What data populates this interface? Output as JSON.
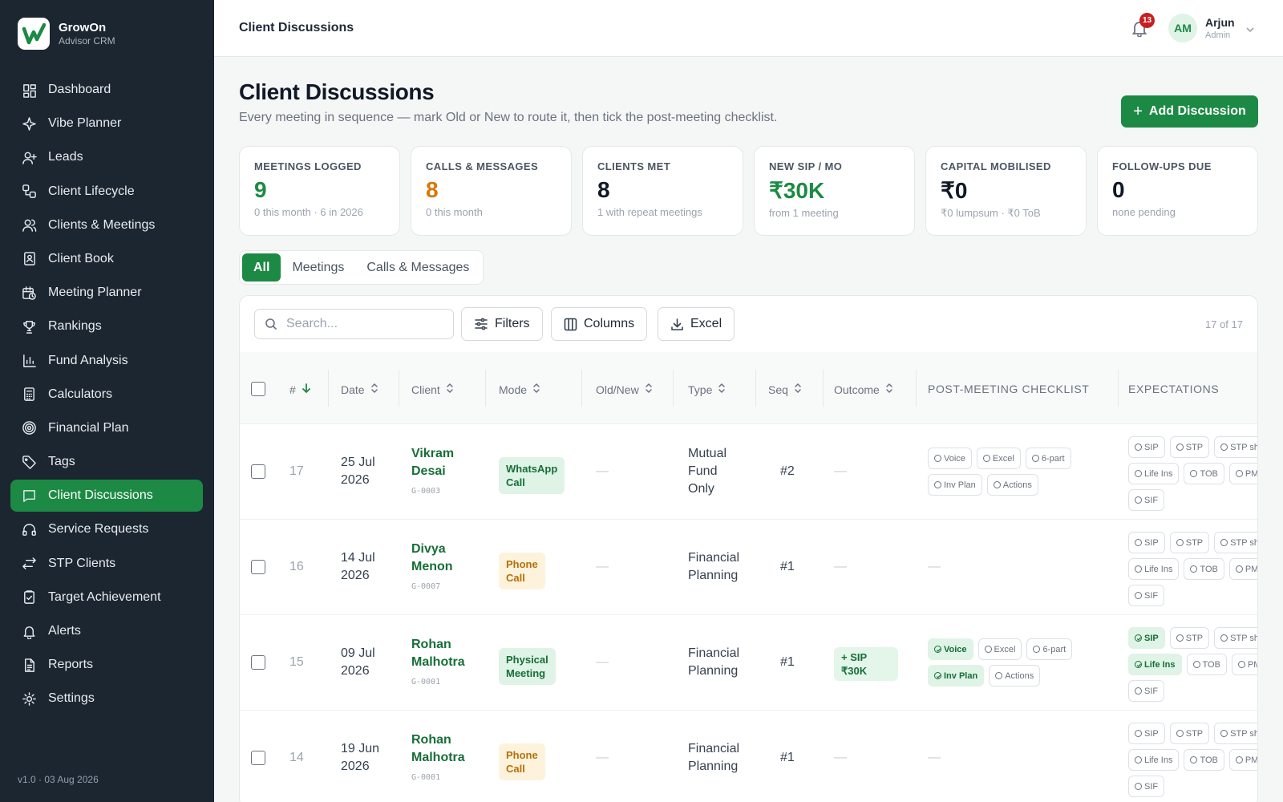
{
  "brand": {
    "name": "GrowOn",
    "sub": "Advisor CRM"
  },
  "nav": [
    {
      "label": "Dashboard",
      "icon": "dashboard-icon"
    },
    {
      "label": "Vibe Planner",
      "icon": "sparkle-icon"
    },
    {
      "label": "Leads",
      "icon": "user-plus-icon"
    },
    {
      "label": "Client Lifecycle",
      "icon": "lifecycle-icon"
    },
    {
      "label": "Clients & Meetings",
      "icon": "users-icon"
    },
    {
      "label": "Client Book",
      "icon": "book-icon"
    },
    {
      "label": "Meeting Planner",
      "icon": "calendar-clock-icon"
    },
    {
      "label": "Rankings",
      "icon": "trophy-icon"
    },
    {
      "label": "Fund Analysis",
      "icon": "bar-chart-icon"
    },
    {
      "label": "Calculators",
      "icon": "calculator-icon"
    },
    {
      "label": "Financial Plan",
      "icon": "target-icon"
    },
    {
      "label": "Tags",
      "icon": "tag-icon"
    },
    {
      "label": "Client Discussions",
      "icon": "message-icon",
      "active": true
    },
    {
      "label": "Service Requests",
      "icon": "headset-icon"
    },
    {
      "label": "STP Clients",
      "icon": "transfer-icon"
    },
    {
      "label": "Target Achievement",
      "icon": "clipboard-check-icon"
    },
    {
      "label": "Alerts",
      "icon": "bell-icon"
    },
    {
      "label": "Reports",
      "icon": "file-text-icon"
    },
    {
      "label": "Settings",
      "icon": "gear-icon"
    }
  ],
  "version": "v1.0 · 03 Aug 2026",
  "topbar": {
    "title": "Client Discussions",
    "notifications": "13",
    "avatar": "AM",
    "user_name": "Arjun",
    "user_role": "Admin"
  },
  "page": {
    "title": "Client Discussions",
    "subtitle": "Every meeting in sequence — mark Old or New to route it, then tick the post-meeting checklist.",
    "add_button": "Add Discussion"
  },
  "stats": [
    {
      "label": "Meetings Logged",
      "value": "9",
      "note": "0 this month · 6 in 2026",
      "color": "#1c8a44"
    },
    {
      "label": "Calls & Messages",
      "value": "8",
      "note": "0 this month",
      "color": "#d97706"
    },
    {
      "label": "Clients Met",
      "value": "8",
      "note": "1 with repeat meetings",
      "color": "#111827"
    },
    {
      "label": "New SIP / Mo",
      "value": "₹30K",
      "note": "from 1 meeting",
      "color": "#1c8a44"
    },
    {
      "label": "Capital Mobilised",
      "value": "₹0",
      "note": "₹0 lumpsum · ₹0 ToB",
      "color": "#111827"
    },
    {
      "label": "Follow-ups Due",
      "value": "0",
      "note": "none pending",
      "color": "#111827"
    }
  ],
  "tabs": [
    "All",
    "Meetings",
    "Calls & Messages"
  ],
  "toolbar": {
    "search_placeholder": "Search...",
    "filters": "Filters",
    "columns": "Columns",
    "excel": "Excel",
    "count": "17 of 17"
  },
  "columns": [
    "#",
    "Date",
    "Client",
    "Mode",
    "Old/New",
    "Type",
    "Seq",
    "Outcome",
    "Post-Meeting Checklist",
    "Expectations"
  ],
  "rows": [
    {
      "num": "17",
      "date": [
        "25 Jul",
        "2026"
      ],
      "client": [
        "Vikram",
        "Desai"
      ],
      "client_id": "G-0003",
      "mode": [
        "WhatsApp",
        "Call"
      ],
      "mode_color": "green",
      "old_new": "—",
      "type": [
        "Mutual",
        "Fund",
        "Only"
      ],
      "seq": "#2",
      "outcome": "—",
      "checklist": [
        {
          "label": "Voice",
          "done": false
        },
        {
          "label": "Excel",
          "done": false
        },
        {
          "label": "6-part",
          "done": false
        },
        {
          "label": "Inv Plan",
          "done": false
        },
        {
          "label": "Actions",
          "done": false
        }
      ],
      "expectations": [
        {
          "label": "SIP",
          "done": false
        },
        {
          "label": "STP",
          "done": false
        },
        {
          "label": "STP sh",
          "done": false
        },
        {
          "label": "Life Ins",
          "done": false
        },
        {
          "label": "TOB",
          "done": false
        },
        {
          "label": "PM",
          "done": false
        },
        {
          "label": "SIF",
          "done": false
        }
      ]
    },
    {
      "num": "16",
      "date": [
        "14 Jul",
        "2026"
      ],
      "client": [
        "Divya",
        "Menon"
      ],
      "client_id": "G-0007",
      "mode": [
        "Phone",
        "Call"
      ],
      "mode_color": "amber",
      "old_new": "—",
      "type": [
        "Financial",
        "Planning"
      ],
      "seq": "#1",
      "outcome": "—",
      "checklist_text": "—",
      "expectations": [
        {
          "label": "SIP",
          "done": false
        },
        {
          "label": "STP",
          "done": false
        },
        {
          "label": "STP sh",
          "done": false
        },
        {
          "label": "Life Ins",
          "done": false
        },
        {
          "label": "TOB",
          "done": false
        },
        {
          "label": "PM",
          "done": false
        },
        {
          "label": "SIF",
          "done": false
        }
      ]
    },
    {
      "num": "15",
      "date": [
        "09 Jul",
        "2026"
      ],
      "client": [
        "Rohan",
        "Malhotra"
      ],
      "client_id": "G-0001",
      "mode": [
        "Physical",
        "Meeting"
      ],
      "mode_color": "green",
      "old_new": "—",
      "type": [
        "Financial",
        "Planning"
      ],
      "seq": "#1",
      "outcome_badge": [
        "+ SIP",
        "₹30K"
      ],
      "checklist": [
        {
          "label": "Voice",
          "done": true
        },
        {
          "label": "Excel",
          "done": false
        },
        {
          "label": "6-part",
          "done": false
        },
        {
          "label": "Inv Plan",
          "done": true
        },
        {
          "label": "Actions",
          "done": false
        }
      ],
      "expectations": [
        {
          "label": "SIP",
          "done": true
        },
        {
          "label": "STP",
          "done": false
        },
        {
          "label": "STP sh",
          "done": false
        },
        {
          "label": "Life Ins",
          "done": true
        },
        {
          "label": "TOB",
          "done": false
        },
        {
          "label": "PM",
          "done": false
        },
        {
          "label": "SIF",
          "done": false
        }
      ]
    },
    {
      "num": "14",
      "date": [
        "19 Jun",
        "2026"
      ],
      "client": [
        "Rohan",
        "Malhotra"
      ],
      "client_id": "G-0001",
      "mode": [
        "Phone",
        "Call"
      ],
      "mode_color": "amber",
      "old_new": "—",
      "type": [
        "Financial",
        "Planning"
      ],
      "seq": "#1",
      "outcome": "—",
      "checklist_text": "—",
      "expectations": [
        {
          "label": "SIP",
          "done": false
        },
        {
          "label": "STP",
          "done": false
        },
        {
          "label": "STP sh",
          "done": false
        },
        {
          "label": "Life Ins",
          "done": false
        },
        {
          "label": "TOB",
          "done": false
        },
        {
          "label": "PM",
          "done": false
        },
        {
          "label": "SIF",
          "done": false
        }
      ]
    }
  ],
  "colors": {
    "sidebar": "#1b2631",
    "accent": "#1c8a44",
    "amber": "#d97706"
  }
}
